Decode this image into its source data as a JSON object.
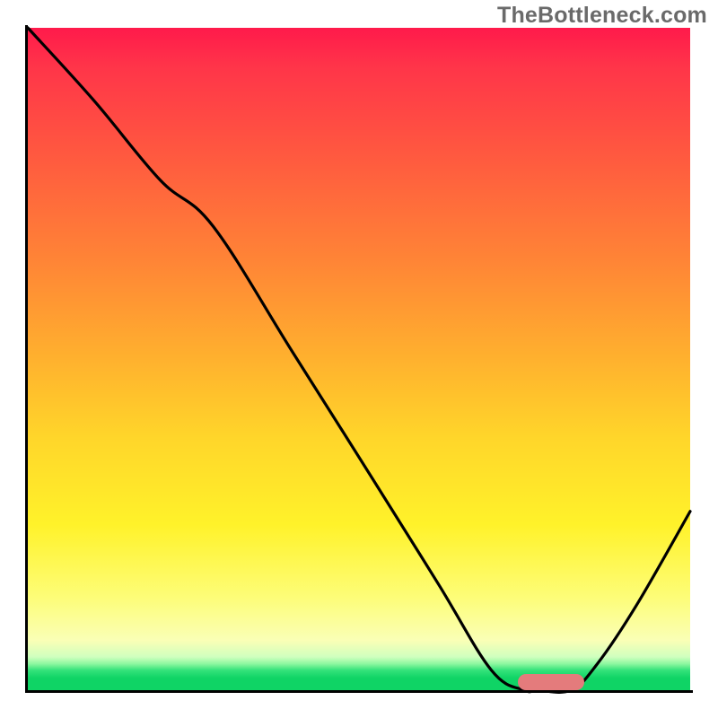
{
  "watermark": "TheBottleneck.com",
  "chart_data": {
    "type": "line",
    "title": "",
    "xlabel": "",
    "ylabel": "",
    "xlim": [
      0,
      100
    ],
    "ylim": [
      0,
      100
    ],
    "x": [
      0,
      10,
      20,
      28,
      40,
      52,
      62,
      70,
      75,
      77,
      82,
      86,
      92,
      100
    ],
    "values": [
      100,
      89,
      77,
      70,
      51,
      32,
      16,
      3,
      0,
      0,
      0,
      4,
      13,
      27
    ],
    "optimal_range_x": [
      74,
      84
    ],
    "colors": {
      "top": "#ff1a4b",
      "mid": "#ffd62a",
      "bottom": "#0fd465",
      "curve": "#000000",
      "marker": "#e47b7c"
    }
  }
}
